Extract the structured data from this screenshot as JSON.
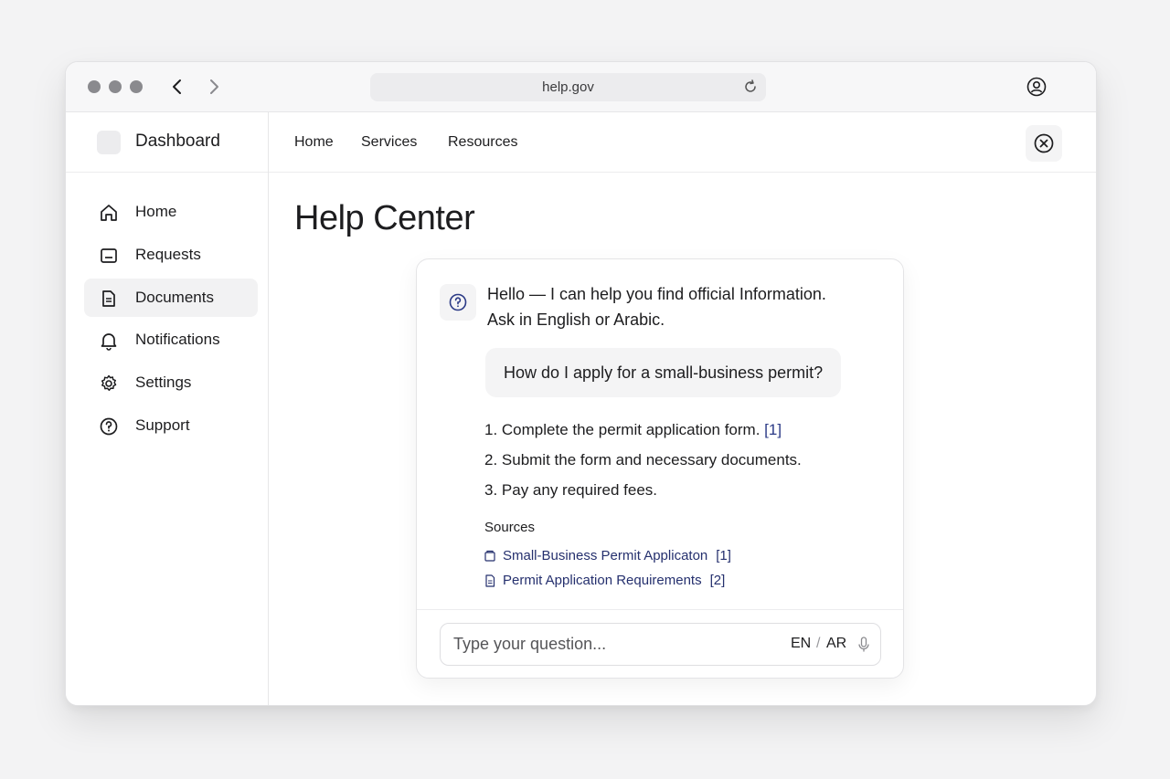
{
  "browser": {
    "url": "help.gov"
  },
  "sidebar": {
    "brand": "Dashboard",
    "items": [
      {
        "label": "Home",
        "icon": "home-icon"
      },
      {
        "label": "Requests",
        "icon": "inbox-icon"
      },
      {
        "label": "Documents",
        "icon": "document-icon",
        "active": true
      },
      {
        "label": "Notifications",
        "icon": "bell-icon"
      },
      {
        "label": "Settings",
        "icon": "gear-icon"
      },
      {
        "label": "Support",
        "icon": "help-circle-icon"
      }
    ]
  },
  "topnav": {
    "links": [
      "Home",
      "Services",
      "Resources"
    ]
  },
  "page": {
    "title": "Help Center"
  },
  "chat": {
    "greeting_line1": "Hello — I can help you find official Information.",
    "greeting_line2": "Ask in English or Arabic.",
    "user_question": "How do I apply for a small-business permit?",
    "steps": [
      {
        "text": "1. Complete the permit application form.",
        "cite": "[1]"
      },
      {
        "text": "2. Submit the form and necessary documents.",
        "cite": ""
      },
      {
        "text": "3. Pay any required fees.",
        "cite": ""
      }
    ],
    "sources_heading": "Sources",
    "sources": [
      {
        "title": "Small-Business Permit Applicaton",
        "ref": "[1]"
      },
      {
        "title": "Permit Application Requirements",
        "ref": "[2]"
      }
    ],
    "input_placeholder": "Type your question...",
    "lang_en": "EN",
    "lang_sep": "/",
    "lang_ar": "AR"
  },
  "colors": {
    "accent": "#2b3a86",
    "page_bg": "#f3f3f4"
  }
}
